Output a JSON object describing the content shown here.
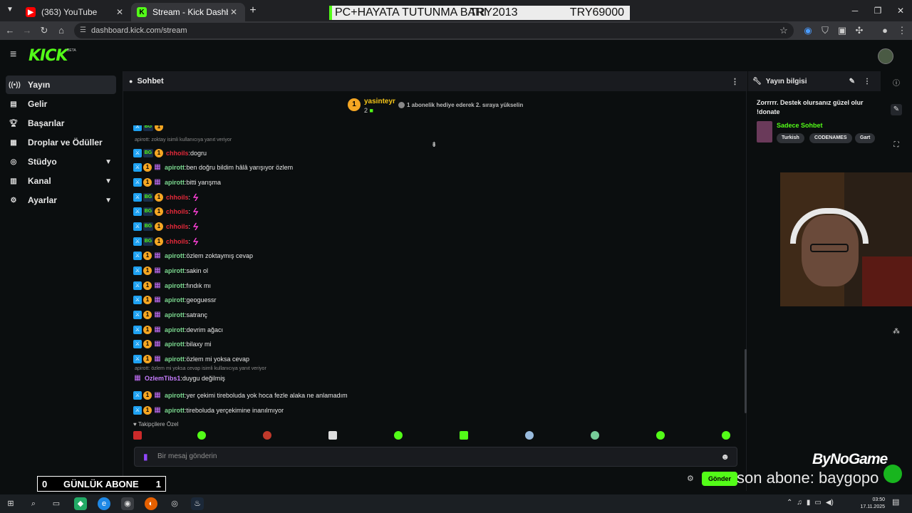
{
  "browser": {
    "tabs": [
      {
        "title": "(363) YouTube",
        "icon": "youtube-icon",
        "color": "#ff0000"
      },
      {
        "title": "Stream - Kick Dashboard",
        "icon": "kick-icon",
        "color": "#53fc18"
      }
    ],
    "url": "dashboard.kick.com/stream"
  },
  "overlay_bar": {
    "left_text": "PC+HAYATA TUTUNMA BARI",
    "mid_text": "TRY2013",
    "right_text": "TRY69000"
  },
  "kick": {
    "logo": "KICK",
    "logo_badge": "BETA",
    "accent": "#53fc18"
  },
  "sidebar": {
    "items": [
      {
        "label": "Yayın",
        "icon": "broadcast-icon"
      },
      {
        "label": "Gelir",
        "icon": "money-icon"
      },
      {
        "label": "Başarılar",
        "icon": "trophy-icon"
      },
      {
        "label": "Droplar ve Ödüller",
        "icon": "gift-icon"
      },
      {
        "label": "Stüdyo",
        "icon": "studio-icon"
      },
      {
        "label": "Kanal",
        "icon": "channel-icon"
      },
      {
        "label": "Ayarlar",
        "icon": "settings-icon"
      }
    ]
  },
  "chat": {
    "header": "Sohbet",
    "pinned": {
      "badge": "1",
      "user": "yasinteyr",
      "count": "2",
      "text": "1 abonelik hediye ederek 2. sıraya yükselin"
    },
    "replies": [
      "apirott: zoktay isimli kullanıcıya yanıt veriyor",
      "apirott: özlem mi yoksa cevap isimli kullanıcıya yanıt veriyor"
    ],
    "messages": [
      {
        "user": "chhoils",
        "text": "dogru"
      },
      {
        "user": "apirott",
        "text": "ben doğru bildim hâlâ yarışıyor özlem"
      },
      {
        "user": "apirott",
        "text": "bitti yarışma"
      },
      {
        "user": "chhoils",
        "text": ""
      },
      {
        "user": "chhoils",
        "text": ""
      },
      {
        "user": "chhoils",
        "text": ""
      },
      {
        "user": "chhoils",
        "text": ""
      },
      {
        "user": "apirott",
        "text": "özlem zoktaymış cevap"
      },
      {
        "user": "apirott",
        "text": "sakin ol"
      },
      {
        "user": "apirott",
        "text": "fındık mı"
      },
      {
        "user": "apirott",
        "text": "geoguessr"
      },
      {
        "user": "apirott",
        "text": "satranç"
      },
      {
        "user": "apirott",
        "text": "devrim ağacı"
      },
      {
        "user": "apirott",
        "text": "bilaxy mi"
      },
      {
        "user": "apirott",
        "text": "özlem mi yoksa cevap"
      },
      {
        "user": "OzlemTibs1",
        "text": "duygu değilmiş"
      },
      {
        "user": "apirott",
        "text": "yer çekimi tireboluda yok hoca fezle alaka ne anlamadım"
      },
      {
        "user": "apirott",
        "text": "tireboluda yerçekimine inanılmıyor"
      }
    ],
    "follower_bar": "Takipçilere Özel",
    "input_placeholder": "Bir mesaj gönderin",
    "send_label": "Gönder"
  },
  "info": {
    "header": "Yayın bilgisi",
    "title": "Zorrrrr. Destek olursanız güzel olur !donate",
    "category": "Sadece Sohbet",
    "tags": [
      "Turkish",
      "CODENAMES",
      "Gart"
    ]
  },
  "stream_overlay": {
    "abone_left": "0",
    "abone_label": "GÜNLÜK ABONE",
    "abone_right": "1",
    "sponsor": "ByNoGame",
    "last_sub": "son abone: baygopo"
  },
  "taskbar": {
    "time": "03:50",
    "date": "17.11.2025"
  }
}
